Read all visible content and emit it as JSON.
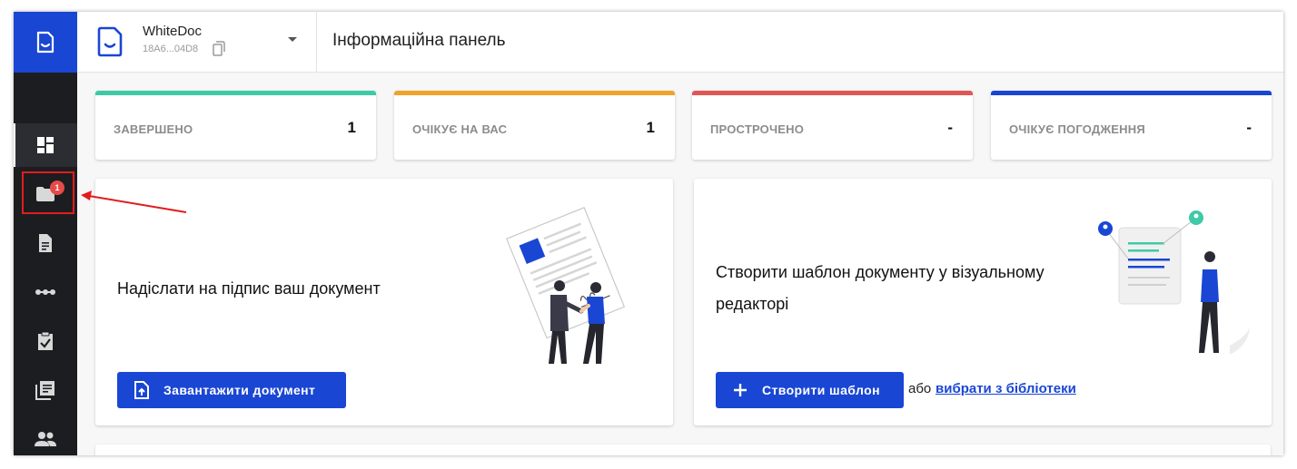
{
  "app": {
    "org_name": "WhiteDoc",
    "org_id": "18A6...04D8",
    "page_title": "Інформаційна панель"
  },
  "sidebar": {
    "items": [
      {
        "icon": "dashboard-icon",
        "active": true
      },
      {
        "icon": "folder-icon",
        "badge": "1"
      },
      {
        "icon": "document-icon"
      },
      {
        "icon": "workflow-dots-icon"
      },
      {
        "icon": "clipboard-check-icon"
      },
      {
        "icon": "library-icon"
      },
      {
        "icon": "users-icon"
      }
    ]
  },
  "stats": [
    {
      "label": "ЗАВЕРШЕНО",
      "value": "1",
      "color": "#3ec9a7"
    },
    {
      "label": "ОЧІКУЄ НА ВАС",
      "value": "1",
      "color": "#f0a32a"
    },
    {
      "label": "ПРОСТРОЧЕНО",
      "value": "-",
      "color": "#e05656"
    },
    {
      "label": "ОЧІКУЄ ПОГОДЖЕННЯ",
      "value": "-",
      "color": "#1a46d4"
    }
  ],
  "cards": {
    "send": {
      "title": "Надіслати на підпис ваш документ",
      "button": "Завантажити документ"
    },
    "template": {
      "title_line1": "Створити шаблон документу у візуальному",
      "title_line2": "редакторі",
      "button": "Створити шаблон",
      "or_text": "або",
      "library_link": "вибрати з бібліотеки"
    }
  },
  "colors": {
    "primary": "#1a46d4",
    "sidebar_bg": "#1c1d21",
    "badge": "#e84a4a",
    "annotation": "#e21c1c"
  }
}
